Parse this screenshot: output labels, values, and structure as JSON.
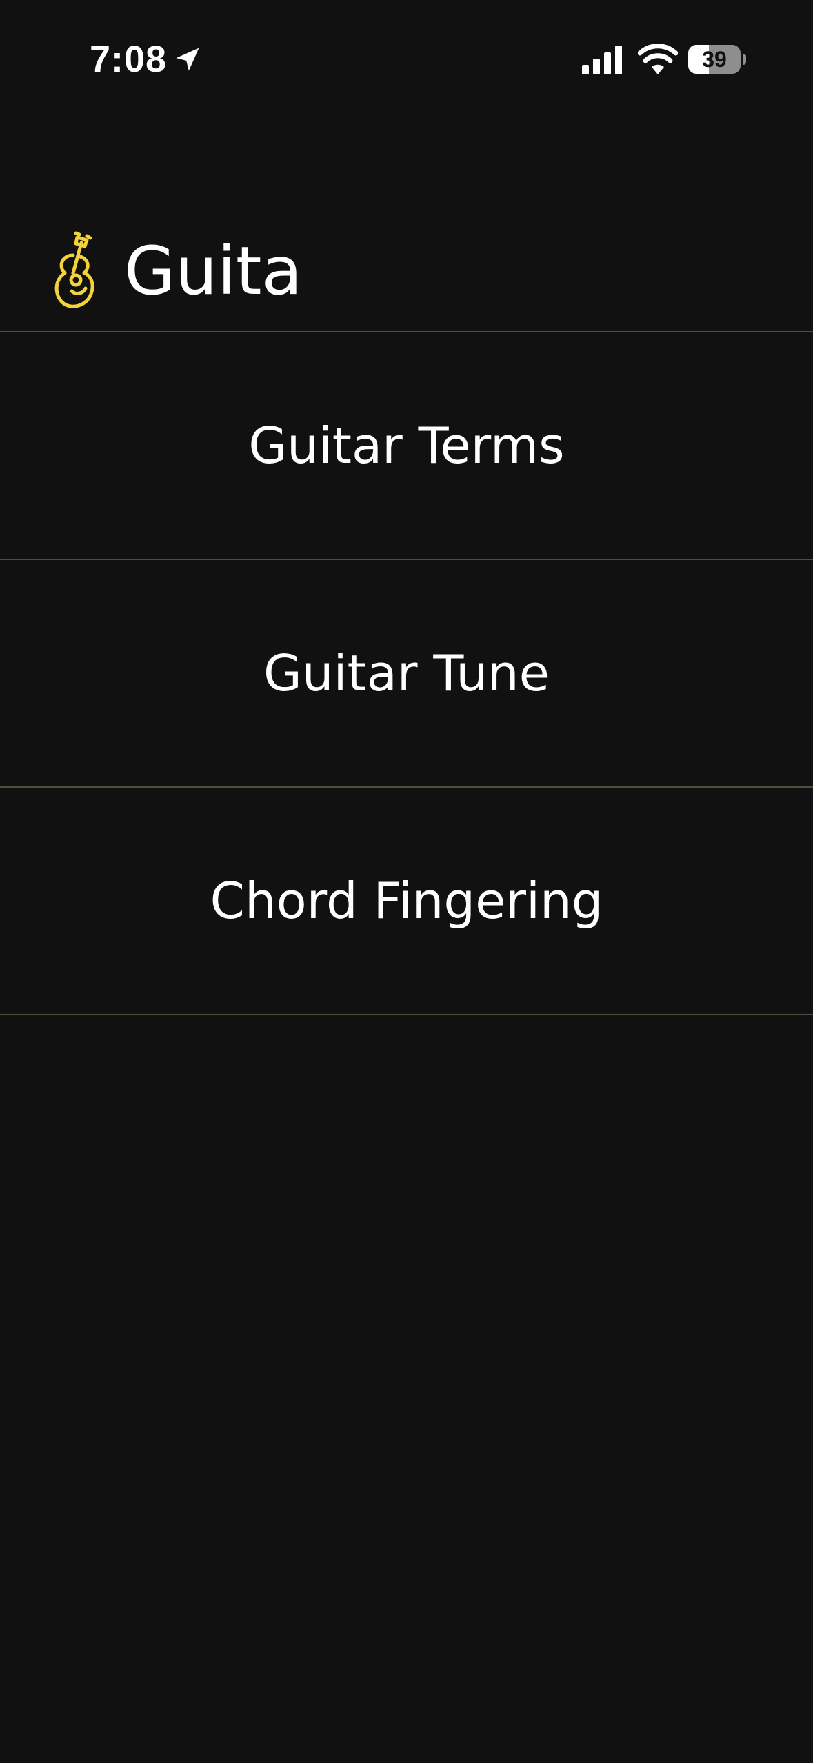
{
  "status_bar": {
    "time": "7:08",
    "battery_percent": "39",
    "battery_level": 0.39,
    "icons": [
      "location-arrow-icon",
      "cellular-signal-icon",
      "wifi-icon",
      "battery-icon"
    ]
  },
  "header": {
    "title": "Guita",
    "logo_icon": "guitar-logo-icon"
  },
  "menu": {
    "items": [
      {
        "label": "Guitar Terms"
      },
      {
        "label": "Guitar Tune"
      },
      {
        "label": "Chord Fingering"
      }
    ]
  },
  "colors": {
    "background": "#111111",
    "text": "#ffffff",
    "divider": "#4e4b3f",
    "accent": "#f3d23a"
  }
}
